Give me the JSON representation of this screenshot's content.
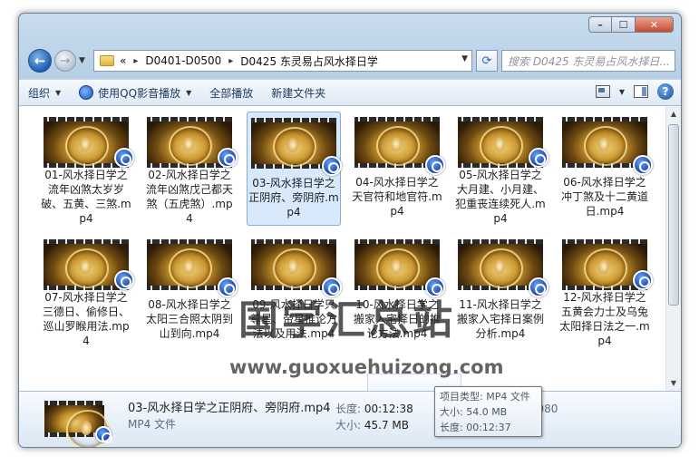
{
  "window": {
    "caption": {
      "minimize": "–",
      "maximize": "☐",
      "close": "✕"
    }
  },
  "address_bar": {
    "overflow": "«",
    "crumbs": [
      "D0401-D0500",
      "D0425 东灵易占风水择日学"
    ],
    "search_placeholder": "搜索 D0425 东灵易占风水择日..."
  },
  "toolbar": {
    "organize": "组织",
    "play_with": "使用QQ影音播放",
    "play_all": "全部播放",
    "new_folder": "新建文件夹"
  },
  "files": [
    "01-风水择日学之流年凶煞太岁岁破、五黄、三煞.mp4",
    "02-风水择日学之流年凶煞戊己都天煞（五虎煞）.mp4",
    "03-风水择日学之正阴府、旁阴府.mp4",
    "04-风水择日学之天官符和地官符.mp4",
    "05-风水择日学之大月建、小月建、犯重丧连续死人.mp4",
    "06-风水择日学之冲丁煞及十二黄道日.mp4",
    "07-风水择日学之三德日、偷修日、巡山罗睺用法.mp4",
    "08-风水择日学之太阳三合照太阴到山到向.mp4",
    "09-风水择日学只尊星、帝星推论方法以及用法.mp4",
    "10-风水择日学之搬家入宅择日的推论方法.mp4",
    "11-风水择日学之搬家入宅择日案例分析.mp4",
    "12-风水择日学之五黄会力士及乌兔太阳择日法之一.mp4"
  ],
  "selected_index": 2,
  "tooltip": {
    "type": "项目类型: MP4 文件",
    "size": "大小: 54.0 MB",
    "length": "长度: 00:12:37"
  },
  "details": {
    "name": "03-风水择日学之正阴府、旁阴府.mp4",
    "type": "MP4 文件",
    "length_label": "长度:",
    "length_value": "00:12:38",
    "size_label": "大小:",
    "size_value": "45.7 MB",
    "extra": "帧高度: 1080"
  },
  "watermark": {
    "text": "国学汇总站",
    "url": "www.guoxuehuizong.com"
  }
}
